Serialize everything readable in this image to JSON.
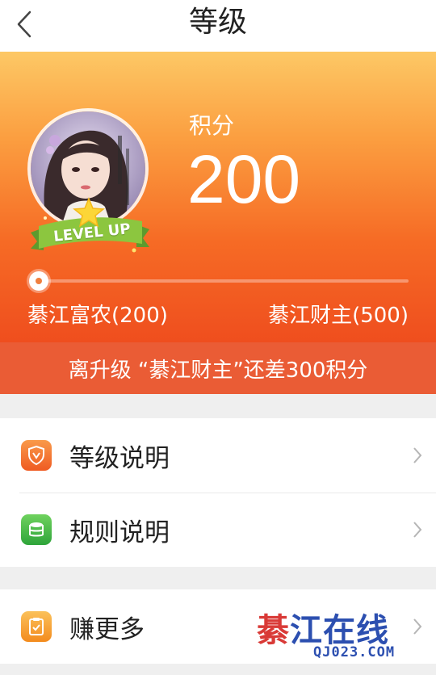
{
  "header": {
    "title": "等级"
  },
  "hero": {
    "points_label": "积分",
    "points_value": "200",
    "badge_text": "LEVEL UP",
    "progress_fraction": 0.0,
    "current_level": "綦江富农(200)",
    "next_level": "綦江财主(500)",
    "upgrade_message": "离升级 “綦江财主”还差300积分"
  },
  "menu": {
    "items": [
      {
        "label": "等级说明",
        "icon": "shield-v-icon",
        "color": "#f26a28"
      },
      {
        "label": "规则说明",
        "icon": "coins-icon",
        "color": "#3cb043"
      }
    ],
    "extra": {
      "label": "赚更多",
      "icon": "clipboard-check-icon",
      "color": "#f59a2a"
    }
  },
  "watermark": {
    "char1": "綦",
    "rest": "江在线",
    "url": "QJ023.COM"
  },
  "colors": {
    "hero_top": "#fdc865",
    "hero_bottom": "#ef4e1e",
    "upgrade_bar": "#ea5c35"
  }
}
